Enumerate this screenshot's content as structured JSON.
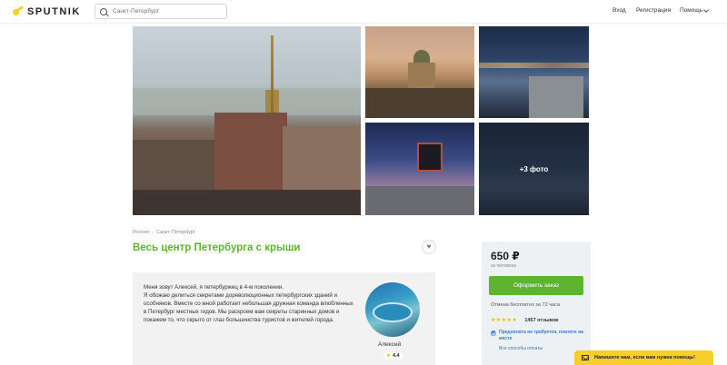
{
  "header": {
    "logo_text": "SPUTNIK",
    "search_placeholder": "Санкт-Петербург",
    "nav_login": "Вход",
    "nav_register": "Регистрация",
    "nav_help": "Помощь"
  },
  "gallery": {
    "more_photos": "+3 фото"
  },
  "breadcrumb": {
    "items": [
      "Россия",
      "Санкт-Петербург"
    ]
  },
  "tour": {
    "title": "Весь центр Петербурга с крыши",
    "description": [
      "Меня зовут Алексей, я петербуржец в 4-м поколении.",
      "Я обожаю делиться секретами дореволюционных петербургских зданий и особняков. Вместе со мной работает небольшая дружная команда влюбленных в Петербург местных гидов. Мы раскроем вам секреты старинных домов и покажем то, что скрыто от глаз большинства туристов и жителей города."
    ]
  },
  "guide": {
    "name": "Алексей",
    "rating": "4.4"
  },
  "booking": {
    "price": "650 ₽",
    "price_note": "за человека",
    "order_button": "Оформить заказ",
    "cancel_note": "Отмена бесплатно за 72 часа",
    "stars": "★★★★★",
    "reviews": "1457 отзывов",
    "prepay_text": "Предоплата не требуется, платите на месте",
    "pay_link": "Все способы оплаты"
  },
  "chat": {
    "text": "Напишите нам, если вам нужна помощь!"
  },
  "colors": {
    "accent_green": "#5fb42f",
    "brand_yellow": "#f7cf2d",
    "link_blue": "#2f7bc8"
  }
}
